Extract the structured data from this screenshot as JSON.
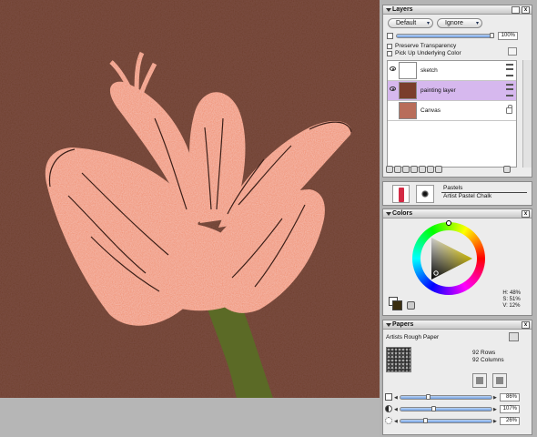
{
  "layers_panel": {
    "title": "Layers",
    "composite_method": "Default",
    "composite_depth": "Ignore",
    "opacity": "100%",
    "preserve_transparency_label": "Preserve Transparency",
    "pick_up_underlying_label": "Pick Up Underlying Color",
    "layers": [
      {
        "name": "sketch",
        "selected": false
      },
      {
        "name": "painting layer",
        "selected": true
      },
      {
        "name": "Canvas",
        "selected": false
      }
    ],
    "selected_color": "#d6b8ee"
  },
  "brush_panel": {
    "category": "Pastels",
    "variant": "Artist Pastel Chalk"
  },
  "colors_panel": {
    "title": "Colors",
    "h_label": "H: 48%",
    "s_label": "S: 51%",
    "v_label": "V: 12%",
    "main_color": "#3a2e10",
    "additional_color": "#ffffff"
  },
  "papers_panel": {
    "title": "Papers",
    "paper_name": "Artists Rough Paper",
    "rows": "92 Rows",
    "columns": "92 Columns",
    "scale": "86%",
    "contrast": "107%",
    "brightness": "26%",
    "scale_level": 0.86,
    "contrast_level": 1.07,
    "brightness_level": 0.26
  },
  "canvas": {
    "background_color": "#6e3c2e",
    "petal_color": "#f08c6a",
    "stem_color": "#5b6a26"
  }
}
